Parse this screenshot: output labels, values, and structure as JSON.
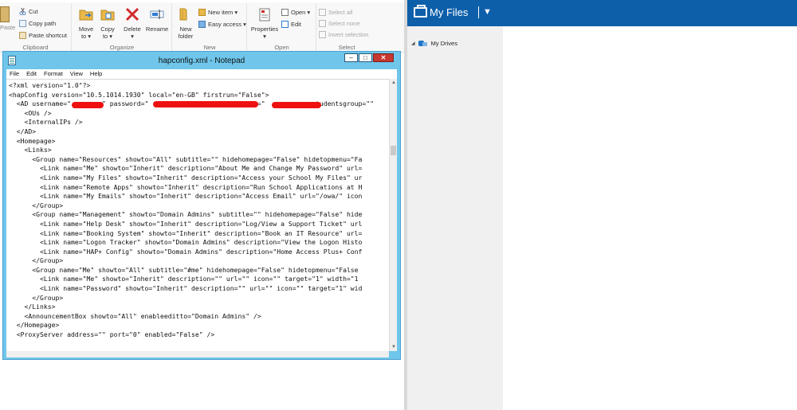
{
  "explorer": {
    "groups": {
      "clipboard": "Clipboard",
      "organize": "Organize",
      "new": "New",
      "open": "Open",
      "select": "Select"
    },
    "buttons": {
      "paste": "Paste",
      "cut": "Cut",
      "copy_path": "Copy path",
      "paste_shortcut": "Paste shortcut",
      "move_to": "Move",
      "move_to_sub": "to ▾",
      "copy_to": "Copy",
      "copy_to_sub": "to ▾",
      "delete": "Delete",
      "delete_sub": "▾",
      "rename": "Rename",
      "new_folder": "New",
      "new_folder_sub": "folder",
      "new_item": "New item ▾",
      "easy_access": "Easy access ▾",
      "properties": "Properties",
      "properties_sub": "▾",
      "open": "Open ▾",
      "edit": "Edit",
      "select_all": "Select all",
      "select_none": "Select none",
      "invert_selection": "Invert selection"
    },
    "colors": {
      "cut": "#4a7ec4",
      "delete": "#d12b2b",
      "folder": "#e9b84a"
    }
  },
  "notepad": {
    "title": "hapconfig.xml - Notepad",
    "menu": [
      "File",
      "Edit",
      "Format",
      "View",
      "Help"
    ],
    "lines": [
      "<?xml version=\"1.0\"?>",
      "<hapConfig version=\"10.5.1014.1930\" local=\"en-GB\" firstrun=\"False\">",
      "  <AD username=\"        \" password=\"                       \" upn=\"            studentsgroup=\"\"",
      "    <OUs />",
      "    <InternalIPs />",
      "  </AD>",
      "  <Homepage>",
      "    <Links>",
      "      <Group name=\"Resources\" showto=\"All\" subtitle=\"\" hidehomepage=\"False\" hidetopmenu=\"Fa",
      "        <Link name=\"Me\" showto=\"Inherit\" description=\"About Me and Change My Password\" url=",
      "        <Link name=\"My Files\" showto=\"Inherit\" description=\"Access your School My Files\" ur",
      "        <Link name=\"Remote Apps\" showto=\"Inherit\" description=\"Run School Applications at H",
      "        <Link name=\"My Emails\" showto=\"Inherit\" description=\"Access Email\" url=\"/owa/\" icon",
      "      </Group>",
      "      <Group name=\"Management\" showto=\"Domain Admins\" subtitle=\"\" hidehomepage=\"False\" hide",
      "        <Link name=\"Help Desk\" showto=\"Inherit\" description=\"Log/View a Support Ticket\" url",
      "        <Link name=\"Booking System\" showto=\"Inherit\" description=\"Book an IT Resource\" url=",
      "        <Link name=\"Logon Tracker\" showto=\"Domain Admins\" description=\"View the Logon Histo",
      "        <Link name=\"HAP+ Config\" showto=\"Domain Admins\" description=\"Home Access Plus+ Conf",
      "      </Group>",
      "      <Group name=\"Me\" showto=\"All\" subtitle=\"#me\" hidehomepage=\"False\" hidetopmenu=\"False",
      "        <Link name=\"Me\" showto=\"Inherit\" description=\"\" url=\"\" icon=\"\" target=\"1\" width=\"1",
      "        <Link name=\"Password\" showto=\"Inherit\" description=\"\" url=\"\" icon=\"\" target=\"1\" wid",
      "      </Group>",
      "    </Links>",
      "    <AnnouncementBox showto=\"All\" enableeditto=\"Domain Admins\" />",
      "  </Homepage>",
      "  <ProxyServer address=\"\" port=\"0\" enabled=\"False\" />"
    ]
  },
  "portal": {
    "title": "My Files",
    "caret": "▼",
    "tree": {
      "arrow": "◢",
      "item": "My Drives"
    },
    "colors": {
      "header": "#0e5faa",
      "sidebar": "#f0f0f0"
    }
  }
}
